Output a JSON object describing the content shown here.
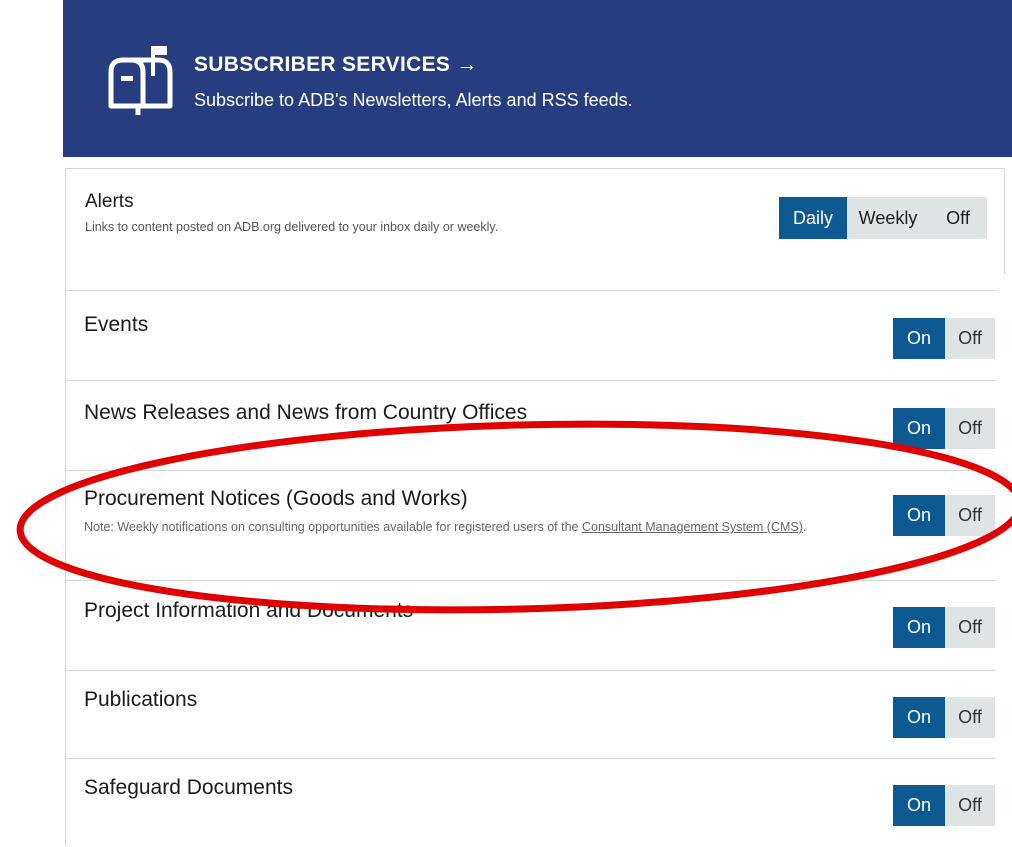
{
  "banner": {
    "title": "SUBSCRIBER SERVICES →",
    "subtitle": "Subscribe to ADB's Newsletters, Alerts and RSS feeds.",
    "icon": "mailbox-icon",
    "background": "#263e7f"
  },
  "alerts": {
    "title": "Alerts",
    "description": "Links to content posted on ADB.org delivered to your inbox daily or weekly.",
    "options": [
      "Daily",
      "Weekly",
      "Off"
    ],
    "selected": "Daily"
  },
  "toggle_colors": {
    "active": "#0d5a93",
    "inactive": "#dfe3e3"
  },
  "items": [
    {
      "title": "Events",
      "on_label": "On",
      "off_label": "Off",
      "state": "On"
    },
    {
      "title": "News Releases and News from Country Offices",
      "on_label": "On",
      "off_label": "Off",
      "state": "On"
    },
    {
      "title": "Procurement Notices (Goods and Works)",
      "note_prefix": "Note: Weekly notifications on consulting opportunities available for registered users of the ",
      "note_link": "Consultant Management System (CMS)",
      "note_suffix": ".",
      "on_label": "On",
      "off_label": "Off",
      "state": "On"
    },
    {
      "title": "Project Information and Documents",
      "on_label": "On",
      "off_label": "Off",
      "state": "On"
    },
    {
      "title": "Publications",
      "on_label": "On",
      "off_label": "Off",
      "state": "On"
    },
    {
      "title": "Safeguard Documents",
      "on_label": "On",
      "off_label": "Off",
      "state": "On"
    }
  ],
  "annotation_color": "#e00000"
}
